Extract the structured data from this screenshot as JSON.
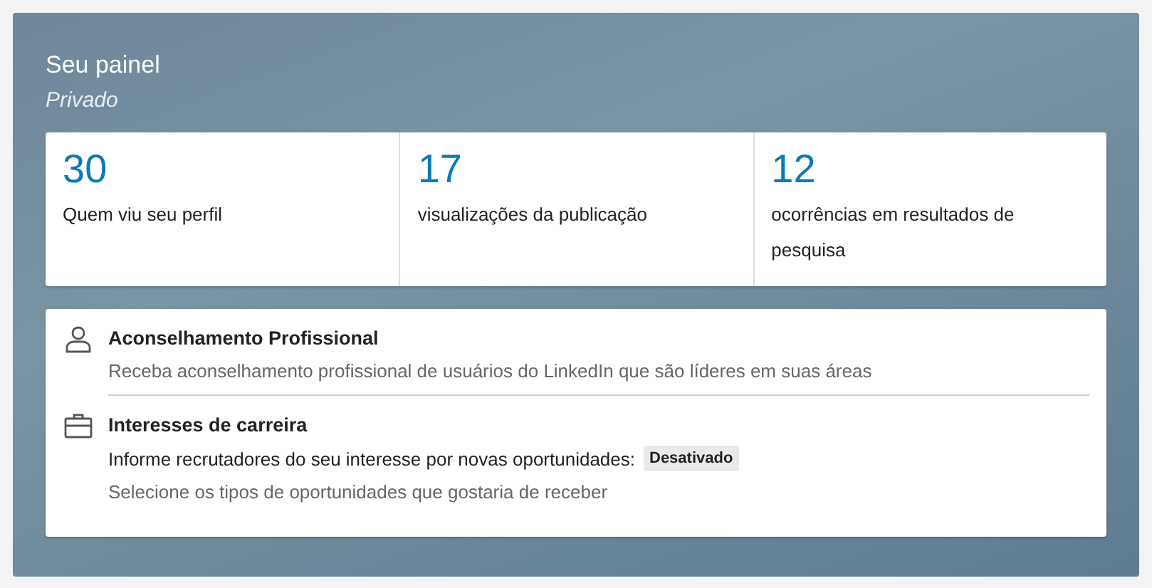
{
  "panel": {
    "title": "Seu painel",
    "subtitle": "Privado"
  },
  "stats": [
    {
      "value": "30",
      "label": "Quem viu seu perfil"
    },
    {
      "value": "17",
      "label": "visualizações da publicação"
    },
    {
      "value": "12",
      "label": "ocorrências em resultados de pesquisa"
    }
  ],
  "features": [
    {
      "kind": "advice",
      "title": "Aconselhamento Profissional",
      "description": "Receba aconselhamento profissional de usuários do LinkedIn que são líderes em suas áreas"
    },
    {
      "kind": "career",
      "title": "Interesses de carreira",
      "status_text": "Informe recrutadores do seu interesse por novas oportunidades:",
      "badge": "Desativado",
      "description": "Selecione os tipos de oportunidades que gostaria de receber"
    }
  ]
}
